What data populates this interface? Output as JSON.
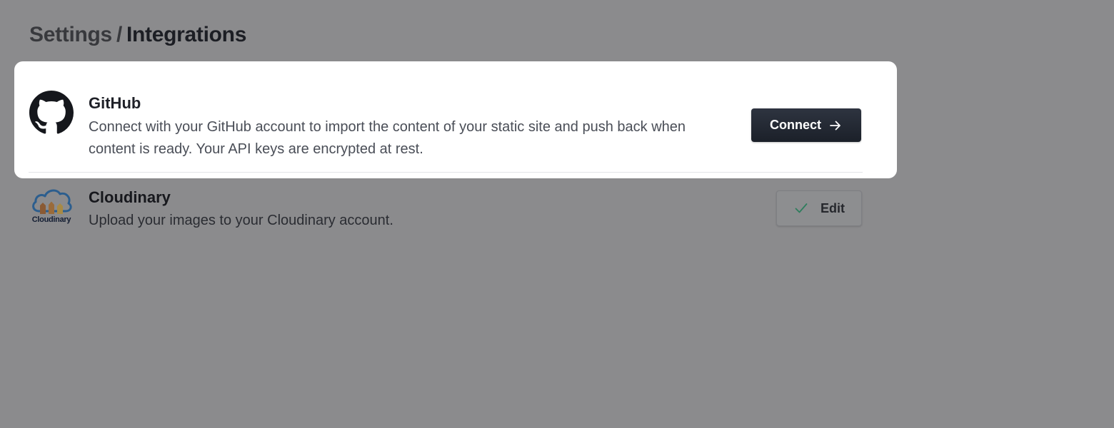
{
  "breadcrumb": {
    "parent": "Settings",
    "separator": "/",
    "current": "Integrations"
  },
  "integrations": [
    {
      "name": "GitHub",
      "description": "Connect with your GitHub account to import the content of your static site and push back when content is ready. Your API keys are encrypted at rest.",
      "logo_icon": "github-icon",
      "action_label": "Connect",
      "action_icon": "arrow-right-icon",
      "status": "not-connected",
      "highlighted": true
    },
    {
      "name": "Cloudinary",
      "description": "Upload your images to your Cloudinary account.",
      "logo_icon": "cloudinary-logo",
      "logo_wordmark": "Cloudinary",
      "action_label": "Edit",
      "action_icon": "check-icon",
      "status": "connected",
      "highlighted": false
    }
  ],
  "colors": {
    "overlay": "#8b8b8d",
    "primary_button": "#1f242d",
    "check": "#2f9e74",
    "card": "#ffffff"
  }
}
